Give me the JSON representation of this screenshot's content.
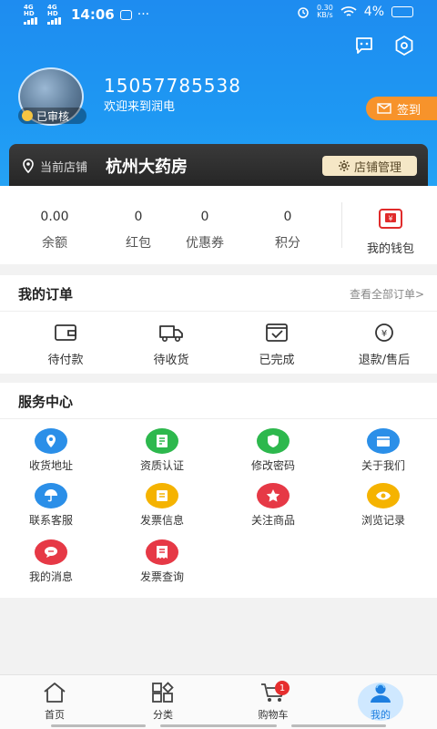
{
  "status": {
    "signal1": "4G HD",
    "signal2": "4G HD",
    "time": "14:06",
    "more": "···",
    "net_speed_value": "0.30",
    "net_speed_unit": "KB/s",
    "battery": "4%"
  },
  "profile": {
    "phone": "15057785538",
    "welcome": "欢迎来到润电",
    "verified": "已审核",
    "signin": "签到"
  },
  "store": {
    "label": "当前店铺",
    "name": "杭州大药房",
    "manage": "店铺管理"
  },
  "assets": [
    {
      "value": "0.00",
      "label": "余额"
    },
    {
      "value": "0",
      "label": "红包"
    },
    {
      "value": "0",
      "label": "优惠券"
    },
    {
      "value": "0",
      "label": "积分"
    }
  ],
  "wallet": {
    "label": "我的钱包"
  },
  "orders": {
    "title": "我的订单",
    "view_all": "查看全部订单>",
    "items": [
      {
        "label": "待付款",
        "icon": "wallet-icon"
      },
      {
        "label": "待收货",
        "icon": "truck-icon"
      },
      {
        "label": "已完成",
        "icon": "check-box-icon"
      },
      {
        "label": "退款/售后",
        "icon": "refund-icon"
      }
    ]
  },
  "service": {
    "title": "服务中心",
    "items": [
      {
        "label": "收货地址",
        "icon": "location-icon",
        "color": "#2b8fe8"
      },
      {
        "label": "资质认证",
        "icon": "certificate-icon",
        "color": "#2db84d"
      },
      {
        "label": "修改密码",
        "icon": "shield-icon",
        "color": "#2db84d"
      },
      {
        "label": "关于我们",
        "icon": "store-icon",
        "color": "#2b8fe8"
      },
      {
        "label": "联系客服",
        "icon": "umbrella-icon",
        "color": "#2b8fe8"
      },
      {
        "label": "发票信息",
        "icon": "invoice-icon",
        "color": "#f5b300"
      },
      {
        "label": "关注商品",
        "icon": "star-icon",
        "color": "#e63946"
      },
      {
        "label": "浏览记录",
        "icon": "eye-icon",
        "color": "#f5b300"
      },
      {
        "label": "我的消息",
        "icon": "chat-icon",
        "color": "#e63946"
      },
      {
        "label": "发票查询",
        "icon": "receipt-icon",
        "color": "#e63946"
      }
    ]
  },
  "tabs": [
    {
      "label": "首页",
      "icon": "home-icon"
    },
    {
      "label": "分类",
      "icon": "category-icon"
    },
    {
      "label": "购物车",
      "icon": "cart-icon"
    },
    {
      "label": "我的",
      "icon": "profile-icon"
    }
  ],
  "cart_badge": "1"
}
